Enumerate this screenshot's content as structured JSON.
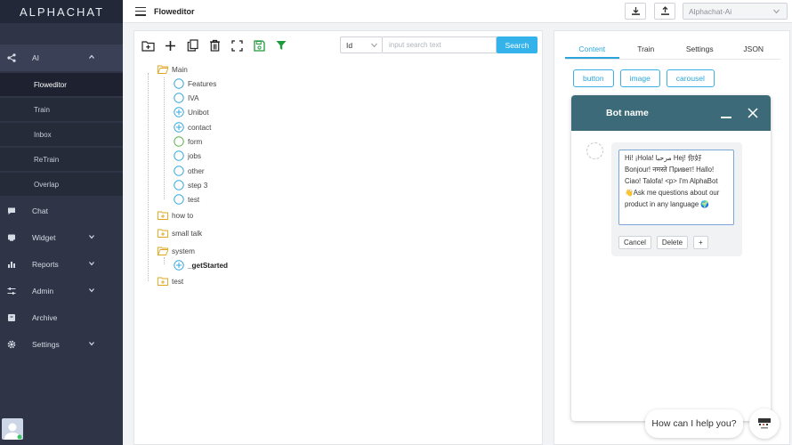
{
  "app": {
    "brand": "ALPHACHAT"
  },
  "header": {
    "title": "Floweditor",
    "bot_select": "Alphachat-Ai"
  },
  "sidebar": {
    "items": [
      {
        "label": "AI",
        "icon": "share-icon",
        "expanded": true
      },
      {
        "label": "Chat",
        "icon": "chat-bubble-icon"
      },
      {
        "label": "Widget",
        "icon": "widget-icon",
        "has_children": true
      },
      {
        "label": "Reports",
        "icon": "bar-chart-icon",
        "has_children": true
      },
      {
        "label": "Admin",
        "icon": "sliders-icon",
        "has_children": true
      },
      {
        "label": "Archive",
        "icon": "archive-icon"
      },
      {
        "label": "Settings",
        "icon": "gear-icon",
        "has_children": true
      }
    ],
    "ai_subitems": [
      "Floweditor",
      "Train",
      "Inbox",
      "ReTrain",
      "Overlap"
    ],
    "active_subitem": "Floweditor"
  },
  "toolbar": {
    "tools": [
      "add-folder-icon",
      "plus-icon",
      "copy-icon",
      "trash-icon",
      "expand-icon",
      "save-icon",
      "filter-icon"
    ],
    "field_select": "Id",
    "search_placeholder": "input search text",
    "search_label": "Search"
  },
  "tree": {
    "main": "Main",
    "main_children": [
      "Features",
      "IVA",
      "Unibot",
      "contact",
      "form",
      "jobs",
      "other",
      "step 3",
      "test"
    ],
    "how_to": "how to",
    "small_talk": "small talk",
    "system": "system",
    "system_children": [
      "_getStarted"
    ],
    "test": "test"
  },
  "right_panel": {
    "tabs": [
      "Content",
      "Train",
      "Settings",
      "JSON"
    ],
    "active_tab": "Content",
    "type_buttons": [
      "button",
      "image",
      "carousel"
    ],
    "bot_name": "Bot name",
    "message_text": "Hi! ¡Hola! مرحبا Hej! 你好 Bonjour! नमस्ते Привет! Hallo! Ciao! Talofa! <p> I'm AlphaBot 👋Ask me questions about our product in any language 🌍",
    "actions": [
      "Cancel",
      "Delete",
      "+"
    ]
  },
  "widget": {
    "help_text": "How can I help you?"
  },
  "colors": {
    "sidebar": "#2f3547",
    "accent": "#33b3ea",
    "bot_header": "#3d6a78",
    "filter_green": "#1f9a3b"
  }
}
